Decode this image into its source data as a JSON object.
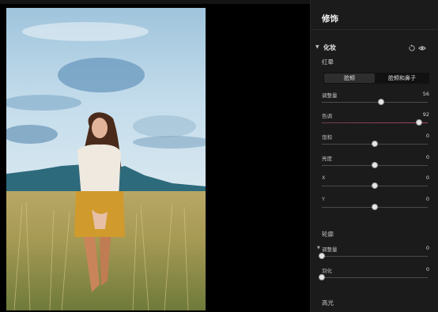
{
  "top_tabs": [
    {
      "color": "#3a3a3a"
    },
    {
      "color": "#1f8fe0"
    }
  ],
  "panel": {
    "title": "修饰",
    "section": {
      "title": "化妆",
      "reset_icon": "reset-icon",
      "visibility_icon": "eye-icon"
    },
    "blush": {
      "label": "红晕",
      "segments": [
        {
          "label": "脸颊",
          "active": true
        },
        {
          "label": "脸颊和鼻子",
          "active": false
        }
      ],
      "sliders": [
        {
          "name": "amount",
          "label": "调整量",
          "value": "56",
          "level": 0.56,
          "hue": false
        },
        {
          "name": "hue",
          "label": "色调",
          "value": "92",
          "level": 0.92,
          "hue": true
        },
        {
          "name": "saturation",
          "label": "饱和",
          "value": "0",
          "level": 0.5,
          "hue": false
        },
        {
          "name": "brightness",
          "label": "亮度",
          "value": "0",
          "level": 0.5,
          "hue": false
        },
        {
          "name": "x",
          "label": "X",
          "value": "0",
          "level": 0.5,
          "hue": false
        },
        {
          "name": "y",
          "label": "Y",
          "value": "0",
          "level": 0.5,
          "hue": false
        }
      ]
    },
    "contour": {
      "label": "轮廓",
      "sliders": [
        {
          "name": "amount",
          "label": "调整量",
          "value": "0",
          "level": 0.0
        },
        {
          "name": "feather",
          "label": "羽化",
          "value": "0",
          "level": 0.0
        }
      ]
    },
    "highlight": {
      "label": "高光"
    }
  }
}
